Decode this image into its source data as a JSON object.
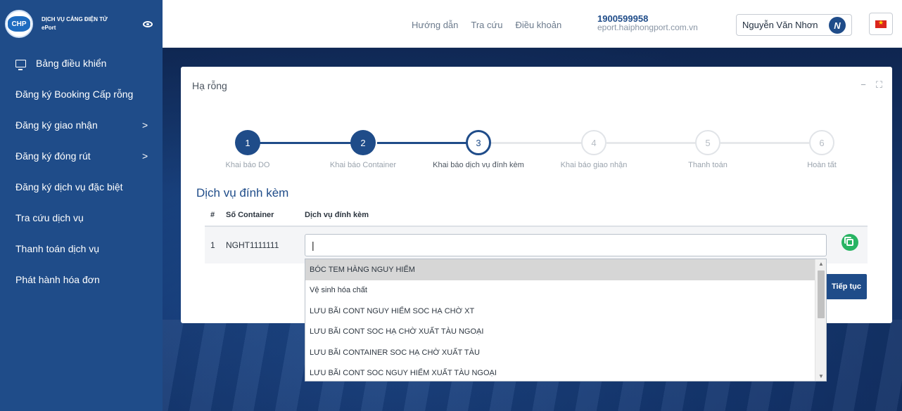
{
  "brand": {
    "line1": "DỊCH VỤ CẢNG ĐIỆN TỬ",
    "line2": "ePort",
    "logo_text": "CHP"
  },
  "header": {
    "links": [
      "Hướng dẫn",
      "Tra cứu",
      "Điều khoản"
    ],
    "hotline": "1900599958",
    "website": "eport.haiphongport.com.vn",
    "user_name": "Nguyễn Văn Nhơn",
    "avatar_letter": "N"
  },
  "sidebar": {
    "items": [
      {
        "label": "Bảng điều khiển",
        "icon": "monitor-icon",
        "has_submenu": false
      },
      {
        "label": "Đăng ký Booking Cấp rỗng",
        "has_submenu": false
      },
      {
        "label": "Đăng ký giao nhận",
        "has_submenu": true
      },
      {
        "label": "Đăng ký đóng rút",
        "has_submenu": true
      },
      {
        "label": "Đăng ký dịch vụ đặc biệt",
        "has_submenu": false
      },
      {
        "label": "Tra cứu dịch vụ",
        "has_submenu": false
      },
      {
        "label": "Thanh toán dịch vụ",
        "has_submenu": false
      },
      {
        "label": "Phát hành hóa đơn",
        "has_submenu": false
      }
    ],
    "chevron": ">"
  },
  "card": {
    "title": "Hạ rỗng",
    "minimize": "−",
    "expand": "⛶"
  },
  "stepper": {
    "steps": [
      {
        "num": "1",
        "label": "Khai báo DO",
        "state": "done"
      },
      {
        "num": "2",
        "label": "Khai báo Container",
        "state": "done"
      },
      {
        "num": "3",
        "label": "Khai báo dịch vụ đính kèm",
        "state": "active"
      },
      {
        "num": "4",
        "label": "Khai báo giao nhận",
        "state": "todo"
      },
      {
        "num": "5",
        "label": "Thanh toán",
        "state": "todo"
      },
      {
        "num": "6",
        "label": "Hoàn tất",
        "state": "todo"
      }
    ]
  },
  "section": {
    "title": "Dịch vụ đính kèm"
  },
  "table": {
    "headers": [
      "#",
      "Số Container",
      "Dịch vụ đính kèm"
    ],
    "rows": [
      {
        "idx": "1",
        "container": "NGHT1111111",
        "service_value": "|"
      }
    ]
  },
  "dropdown": {
    "options": [
      "BÓC TEM HÀNG NGUY HIỂM",
      "Vệ sinh hóa chất",
      "LƯU BÃI CONT NGUY HIỂM SOC HẠ CHỜ XT",
      "LƯU BÃI CONT SOC HẠ CHỜ XUẤT TÀU NGOẠI",
      "LƯU BÃI CONTAINER SOC HẠ CHỜ XUẤT TÀU",
      "LƯU BÃI CONT SOC NGUY HIỂM XUẤT TÀU NGOẠI"
    ],
    "highlighted_index": 0
  },
  "buttons": {
    "next": "Tiếp tục"
  },
  "colors": {
    "primary": "#1f4c89",
    "success": "#28b463"
  }
}
